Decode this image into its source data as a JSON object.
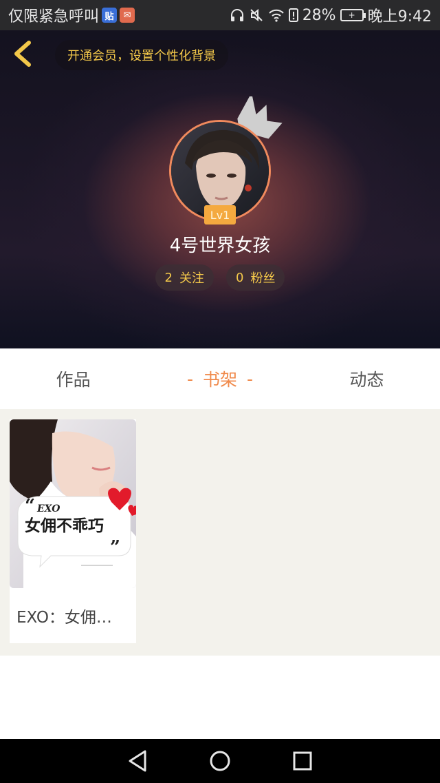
{
  "status_bar": {
    "left_text": "仅限紧急呼叫",
    "app_badge_1": "贴",
    "app_badge_2": "✉",
    "battery_percent": "28%",
    "time": "晚上9:42"
  },
  "header": {
    "member_prompt": "开通会员，设置个性化背景",
    "level": "Lv1",
    "username": "4号世界女孩",
    "following_count": "2",
    "following_label": "关注",
    "fans_count": "0",
    "fans_label": "粉丝"
  },
  "tabs": [
    {
      "label": "作品",
      "active": false
    },
    {
      "label": "书架",
      "active": true
    },
    {
      "label": "动态",
      "active": false
    }
  ],
  "shelf": {
    "books": [
      {
        "cover_small_text": "EXO",
        "cover_main_text": "女佣不乖巧",
        "title": "EXO：女佣…"
      }
    ]
  },
  "colors": {
    "accent": "#f08a4b",
    "gold": "#f3c84a",
    "shelf_bg": "#f3f2ec"
  },
  "icons": {
    "back": "chevron-left-icon",
    "crown": "crown-icon",
    "nav_back": "triangle-back-icon",
    "nav_home": "circle-home-icon",
    "nav_recent": "square-recent-icon"
  }
}
